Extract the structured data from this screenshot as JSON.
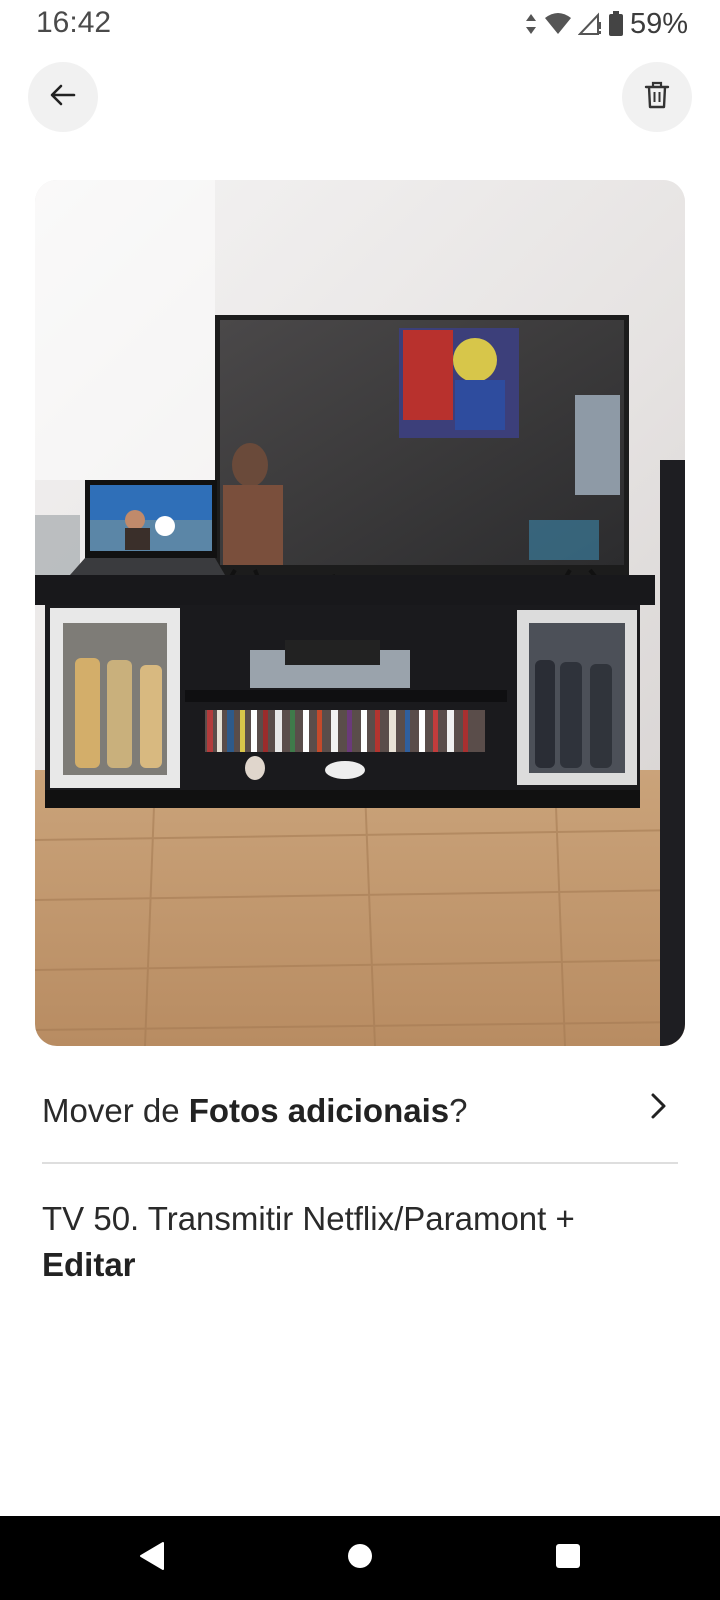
{
  "status_bar": {
    "time": "16:42",
    "battery": "59%"
  },
  "icons": {
    "back": "arrow-left-icon",
    "delete": "trash-icon",
    "chevron": "chevron-right-icon"
  },
  "move_prompt": {
    "prefix": "Mover de ",
    "album": "Fotos adicionais",
    "suffix": "?"
  },
  "caption": {
    "text": "TV 50. Transmitir Netflix/Paramont +",
    "edit_label": "Editar"
  },
  "colors": {
    "background": "#ffffff",
    "button_bg": "#f1f1f1",
    "text": "#222222",
    "divider": "#dedede",
    "nav_bar": "#000000"
  }
}
